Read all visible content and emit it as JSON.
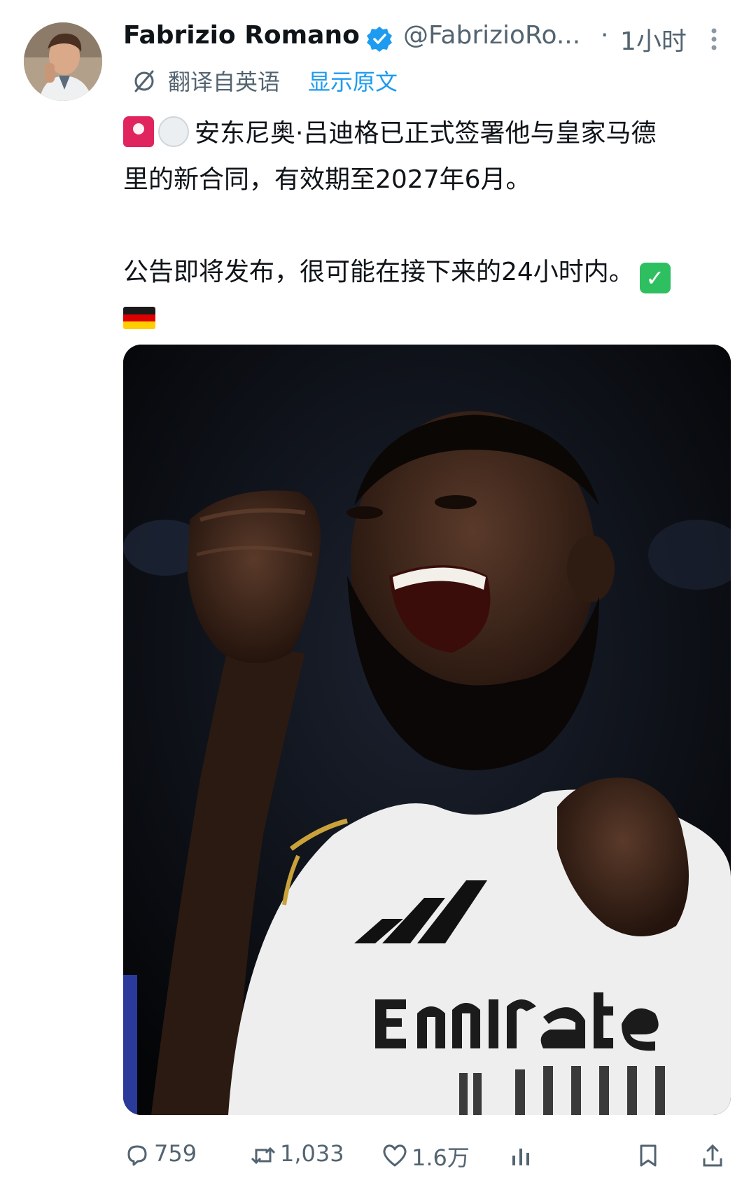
{
  "author": {
    "name": "Fabrizio Romano",
    "handle": "@FabrizioRo...",
    "separator": "·",
    "time": "1小时"
  },
  "translation": {
    "label": "翻译自英语",
    "show_original": "显示原文"
  },
  "tweet": {
    "line1": "安东尼奥·吕迪格已正式签署他与皇家马德",
    "line2": "里的新合同，有效期至2027年6月。",
    "line3": "公告即将发布，很可能在接下来的24小时内。"
  },
  "actions": {
    "replies": "759",
    "retweets": "1,033",
    "likes": "1.6万"
  },
  "colors": {
    "accent": "#1d9bf0",
    "muted": "#536471",
    "text": "#0f1419"
  },
  "icons": {
    "verified": "verified-badge-icon",
    "more": "more-dots-icon",
    "translate": "translate-icon",
    "reply": "reply-icon",
    "retweet": "retweet-icon",
    "like": "heart-icon",
    "views": "views-icon",
    "bookmark": "bookmark-icon",
    "share": "share-icon"
  }
}
